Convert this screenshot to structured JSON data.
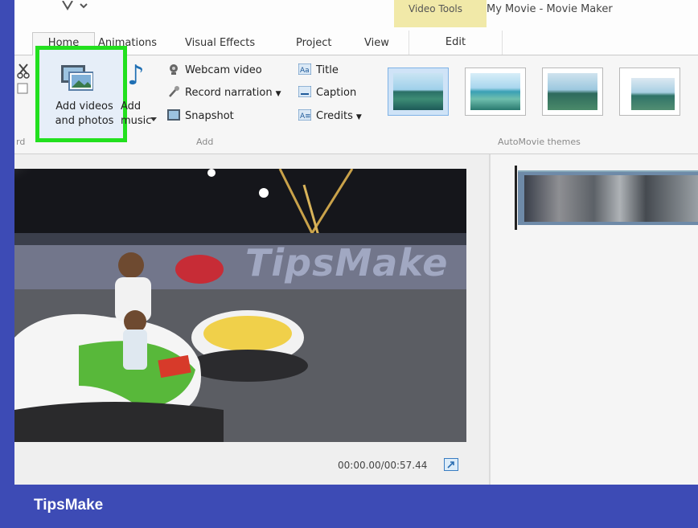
{
  "window": {
    "title": "My Movie - Movie Maker",
    "context_tab_group": "Video Tools"
  },
  "tabs": [
    {
      "label": "Home",
      "active": true
    },
    {
      "label": "Animations"
    },
    {
      "label": "Visual Effects"
    },
    {
      "label": "Project"
    },
    {
      "label": "View"
    },
    {
      "label": "Edit"
    }
  ],
  "ribbon": {
    "clipboard_label_partial": "rd",
    "add_videos": "Add videos\nand photos",
    "add_music": "Add\nmusic",
    "webcam_video": "Webcam video",
    "record_narration": "Record narration",
    "snapshot": "Snapshot",
    "title": "Title",
    "caption": "Caption",
    "credits": "Credits",
    "add_group_label": "Add",
    "themes_group_label": "AutoMovie themes"
  },
  "preview": {
    "watermark": "TipsMake",
    "timecode": "00:00.00/00:57.44"
  },
  "banner": {
    "text": "TipsMake"
  },
  "colors": {
    "highlight": "#22e01e",
    "banner": "#3d4bb5",
    "context_tab": "#f1e9a8"
  }
}
